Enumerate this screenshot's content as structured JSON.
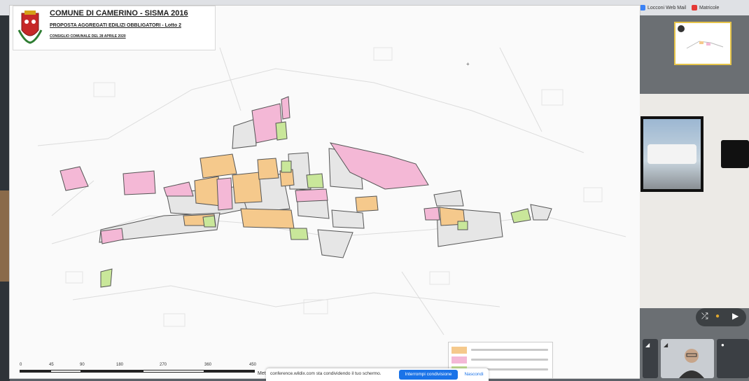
{
  "bookmarks": [
    {
      "label": "Locconi Web Mail",
      "icon": "mail-icon",
      "color": "#3b82f6"
    },
    {
      "label": "Matricole",
      "icon": "matricole-icon",
      "color": "#e53935"
    }
  ],
  "map": {
    "title": "COMUNE DI CAMERINO - SISMA 2016",
    "subtitle": "PROPOSTA AGGREGATI EDILIZI OBBLIGATORI - Lotto 2",
    "meeting": "CONSIGLIO COMUNALE DEL 28 APRILE 2020",
    "scale_labels": [
      "0",
      "45",
      "90",
      "180",
      "270",
      "360",
      "450"
    ],
    "scale_unit": "Metri",
    "legend_colors": [
      "#f5c98c",
      "#f4b8d6",
      "#c9e79a"
    ],
    "colors": {
      "orange": "#f5c98c",
      "pink": "#f4b8d6",
      "green": "#c9e79a",
      "grey": "#e6e6e6"
    }
  },
  "share_banner": {
    "message": "conference.wildix.com sta condividendo il tuo schermo.",
    "stop_label": "Interrompi condivisione",
    "hide_label": "Nascondi"
  }
}
